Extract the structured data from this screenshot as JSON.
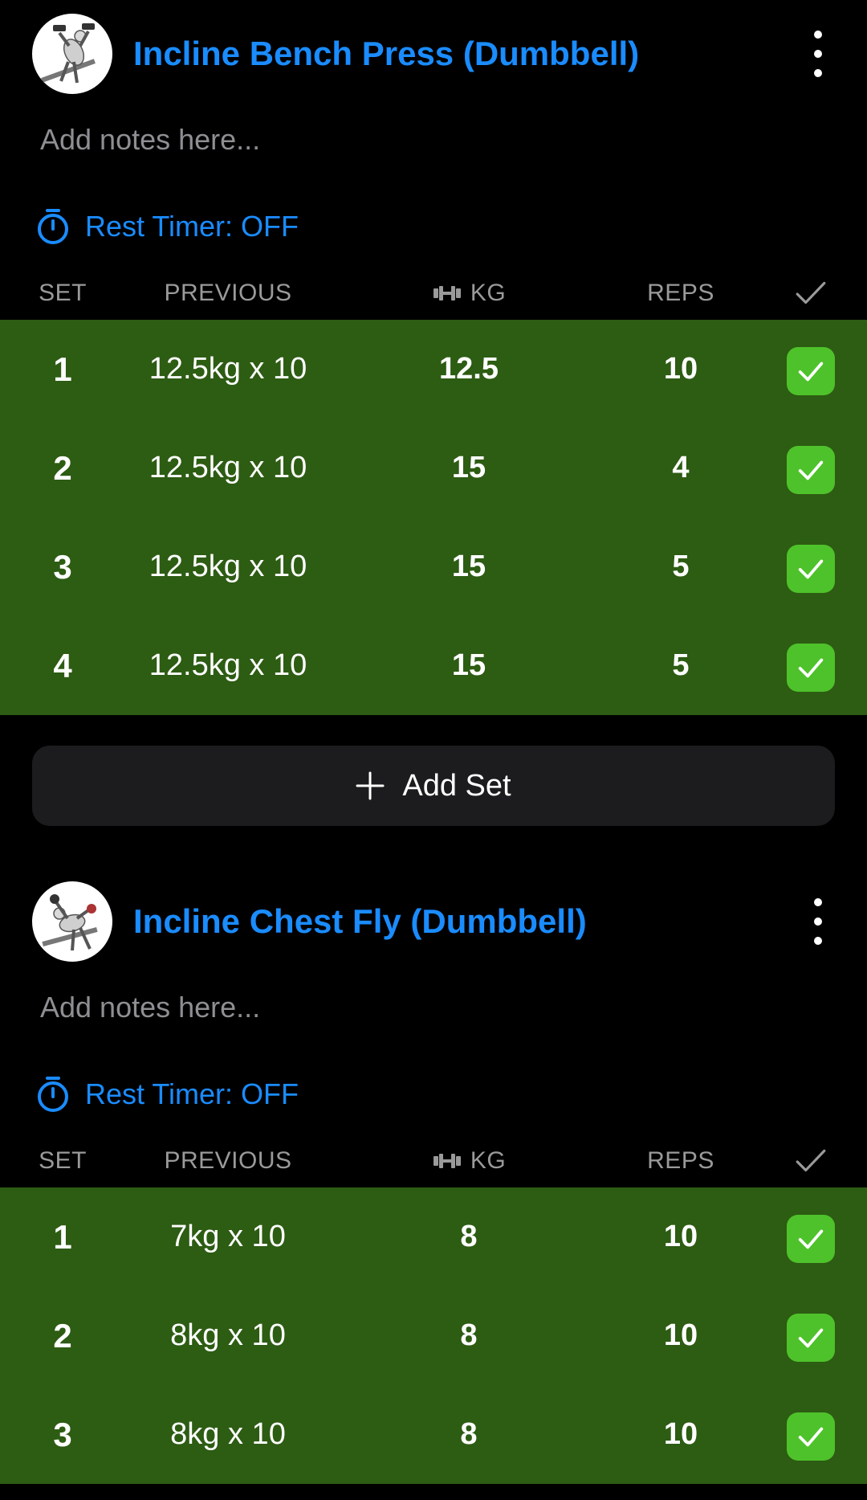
{
  "columns": {
    "set": "SET",
    "previous": "PREVIOUS",
    "kg": "KG",
    "reps": "REPS"
  },
  "exercises": [
    {
      "title": "Incline Bench Press (Dumbbell)",
      "notes_placeholder": "Add notes here...",
      "rest_timer": "Rest Timer: OFF",
      "sets": [
        {
          "set": "1",
          "previous": "12.5kg x 10",
          "kg": "12.5",
          "reps": "10",
          "completed": true
        },
        {
          "set": "2",
          "previous": "12.5kg x 10",
          "kg": "15",
          "reps": "4",
          "completed": true
        },
        {
          "set": "3",
          "previous": "12.5kg x 10",
          "kg": "15",
          "reps": "5",
          "completed": true
        },
        {
          "set": "4",
          "previous": "12.5kg x 10",
          "kg": "15",
          "reps": "5",
          "completed": true
        }
      ],
      "add_set_label": "Add Set"
    },
    {
      "title": "Incline Chest Fly (Dumbbell)",
      "notes_placeholder": "Add notes here...",
      "rest_timer": "Rest Timer: OFF",
      "sets": [
        {
          "set": "1",
          "previous": "7kg x 10",
          "kg": "8",
          "reps": "10",
          "completed": true
        },
        {
          "set": "2",
          "previous": "8kg x 10",
          "kg": "8",
          "reps": "10",
          "completed": true
        },
        {
          "set": "3",
          "previous": "8kg x 10",
          "kg": "8",
          "reps": "10",
          "completed": true
        }
      ]
    }
  ],
  "colors": {
    "accent": "#1a8cff",
    "completed_row": "#2d5c13",
    "check_green": "#4ec22a",
    "background": "#000000",
    "add_set_button": "#1c1c1e"
  }
}
